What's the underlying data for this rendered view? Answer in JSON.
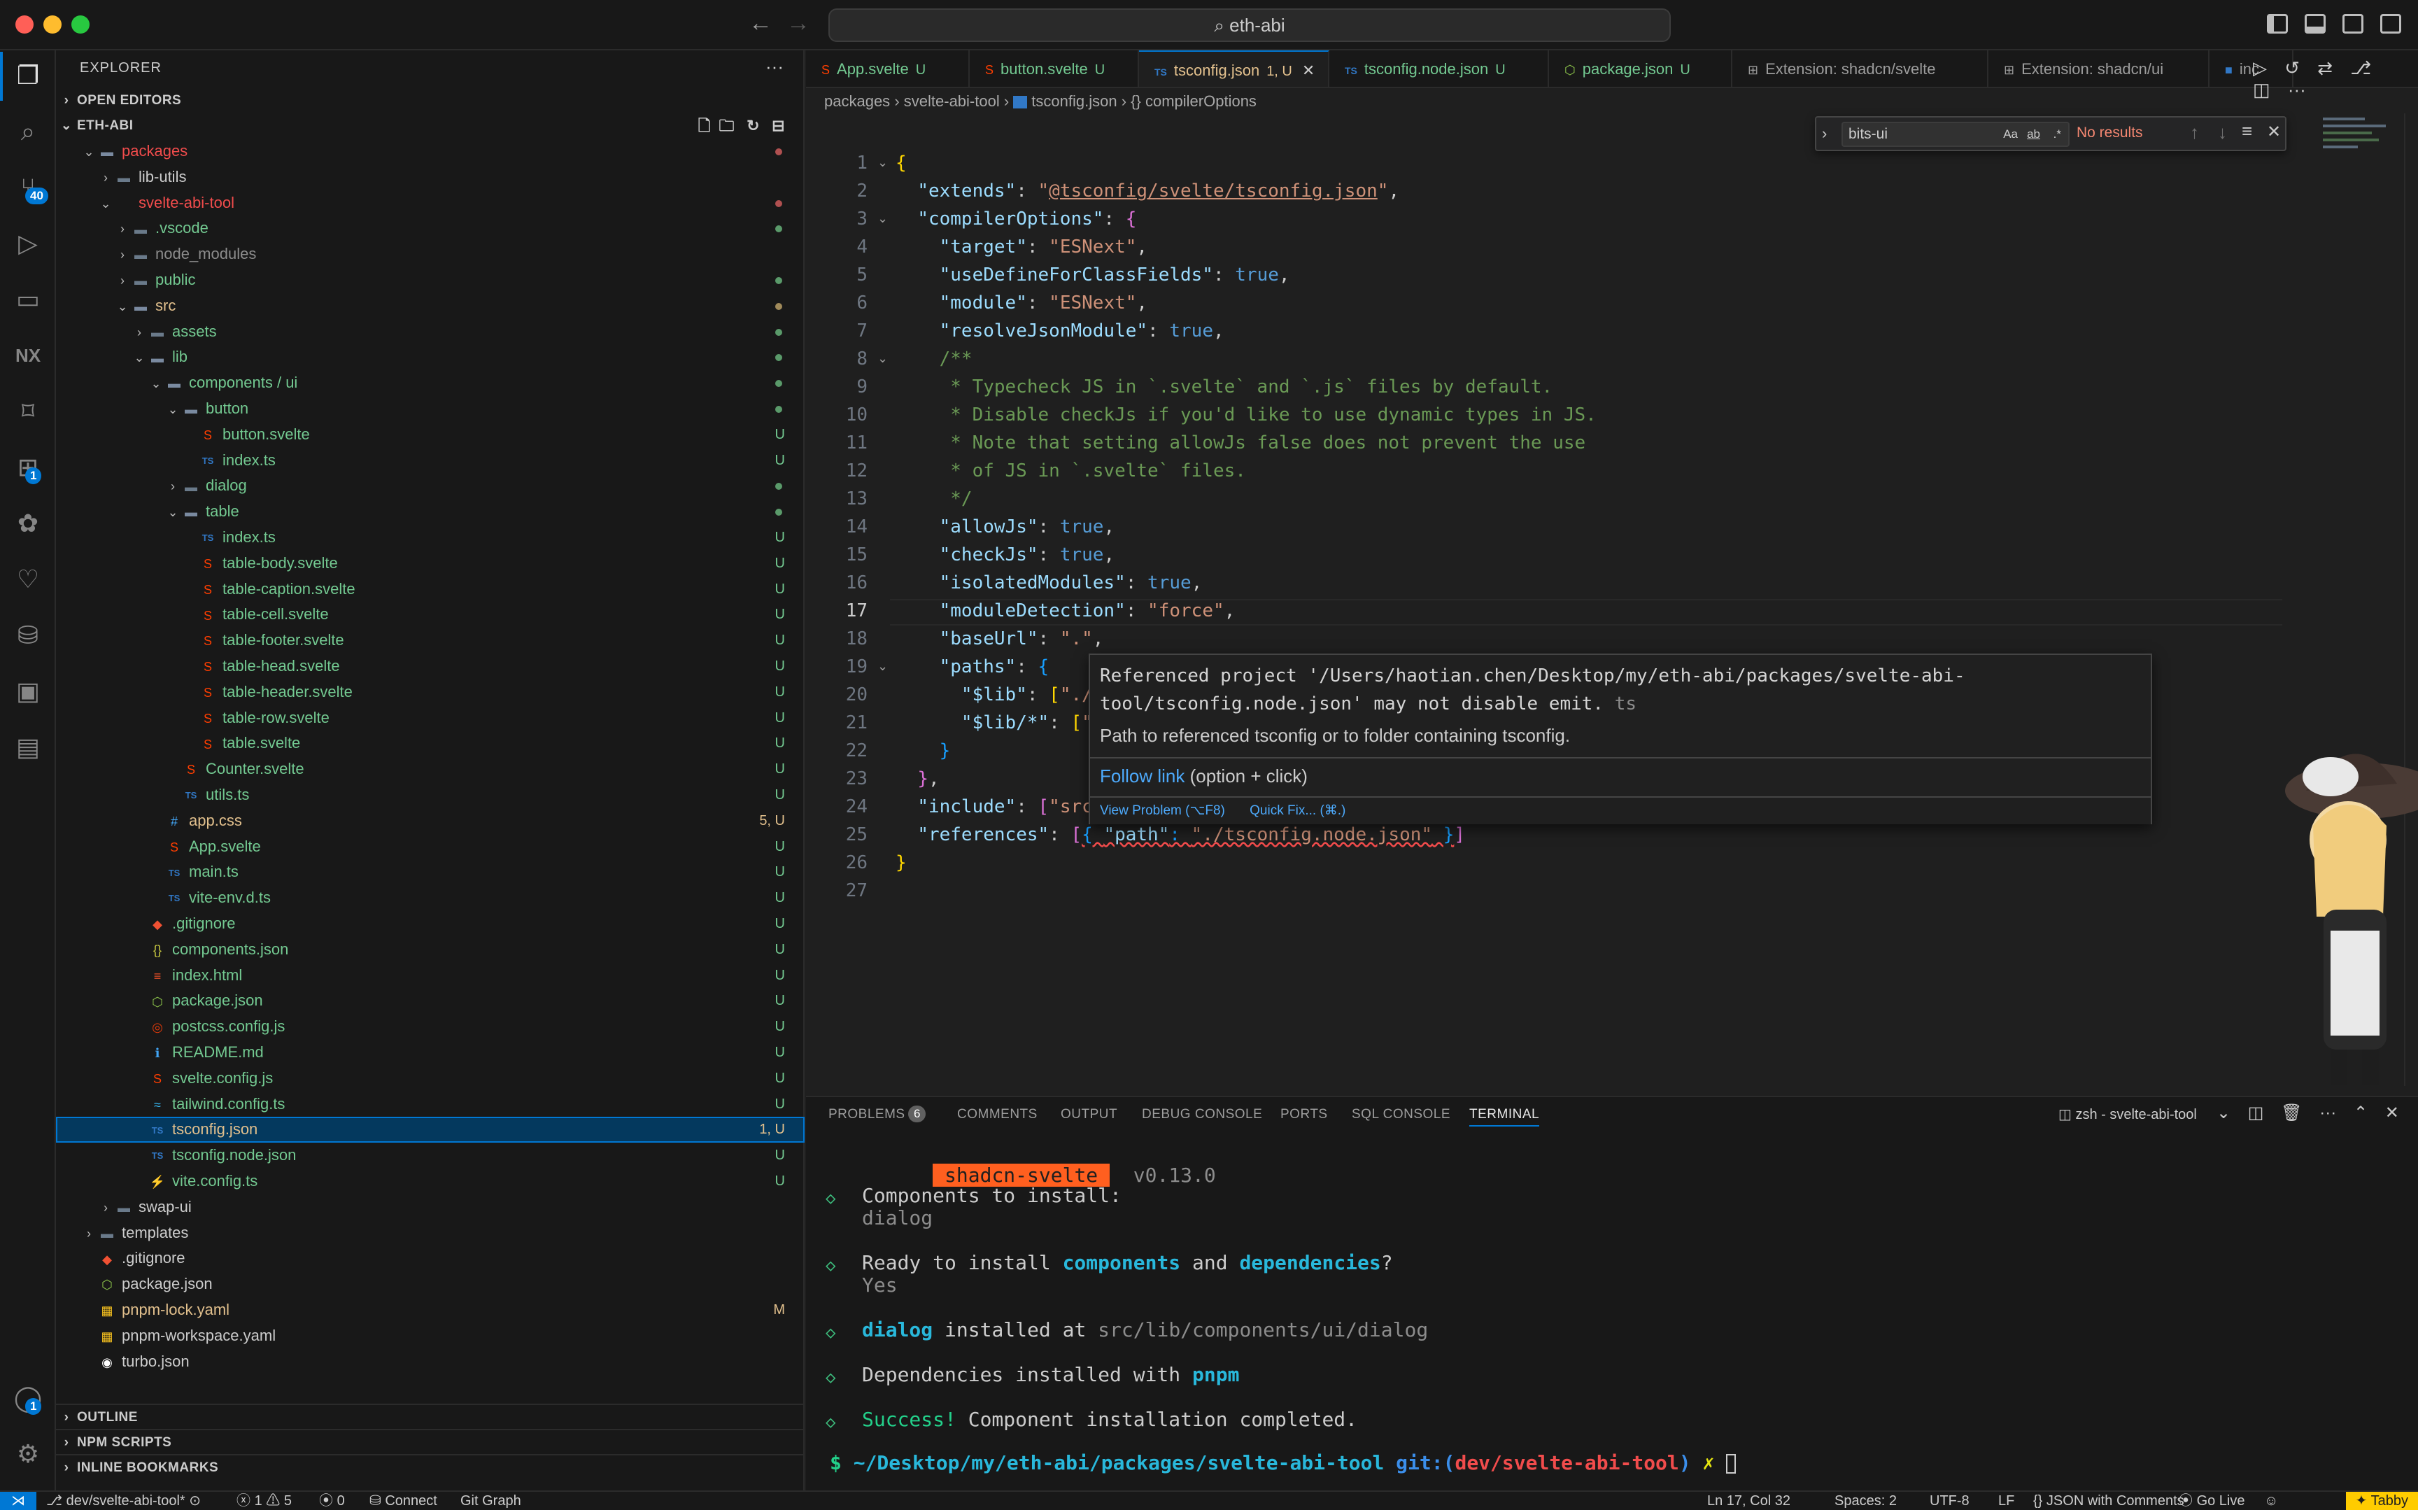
{
  "window": {
    "command_center": "eth-abi"
  },
  "activity": {
    "scm_badge": "40",
    "extensions_badge": "1",
    "accounts_badge": "1"
  },
  "sidebar": {
    "title": "EXPLORER",
    "open_editors": "OPEN EDITORS",
    "root": "ETH-ABI",
    "outline": "OUTLINE",
    "npm_scripts": "NPM SCRIPTS",
    "inline_bookmarks": "INLINE BOOKMARKS",
    "tree": [
      {
        "label": "packages",
        "indent": 1,
        "type": "folder-open",
        "color": "#f14c4c",
        "status": "",
        "dot": "#b05050"
      },
      {
        "label": "lib-utils",
        "indent": 2,
        "type": "folder",
        "color": "#cccccc",
        "status": "",
        "dot": ""
      },
      {
        "label": "svelte-abi-tool",
        "indent": 2,
        "type": "folder-open-plain",
        "color": "#f14c4c",
        "status": "",
        "dot": "#b05050"
      },
      {
        "label": ".vscode",
        "indent": 3,
        "type": "folder",
        "color": "#73c991",
        "status": "",
        "dot": "#5a9a6a"
      },
      {
        "label": "node_modules",
        "indent": 3,
        "type": "folder",
        "color": "#8c8c8c",
        "status": "",
        "dot": ""
      },
      {
        "label": "public",
        "indent": 3,
        "type": "folder",
        "color": "#73c991",
        "status": "",
        "dot": "#5a9a6a"
      },
      {
        "label": "src",
        "indent": 3,
        "type": "folder-open",
        "color": "#e2c08d",
        "status": "",
        "dot": "#a08a5a"
      },
      {
        "label": "assets",
        "indent": 4,
        "type": "folder",
        "color": "#73c991",
        "status": "",
        "dot": "#5a9a6a"
      },
      {
        "label": "lib",
        "indent": 4,
        "type": "folder-open",
        "color": "#73c991",
        "status": "",
        "dot": "#5a9a6a"
      },
      {
        "label": "components / ui",
        "indent": 5,
        "type": "folder-open",
        "color": "#73c991",
        "status": "",
        "dot": "#5a9a6a"
      },
      {
        "label": "button",
        "indent": 6,
        "type": "folder-open",
        "color": "#73c991",
        "status": "",
        "dot": "#5a9a6a"
      },
      {
        "label": "button.svelte",
        "indent": 7,
        "type": "svelte",
        "color": "#73c991",
        "status": "U",
        "dot": ""
      },
      {
        "label": "index.ts",
        "indent": 7,
        "type": "ts",
        "color": "#73c991",
        "status": "U",
        "dot": ""
      },
      {
        "label": "dialog",
        "indent": 6,
        "type": "folder",
        "color": "#73c991",
        "status": "",
        "dot": "#5a9a6a"
      },
      {
        "label": "table",
        "indent": 6,
        "type": "folder-open",
        "color": "#73c991",
        "status": "",
        "dot": "#5a9a6a"
      },
      {
        "label": "index.ts",
        "indent": 7,
        "type": "ts",
        "color": "#73c991",
        "status": "U",
        "dot": ""
      },
      {
        "label": "table-body.svelte",
        "indent": 7,
        "type": "svelte",
        "color": "#73c991",
        "status": "U",
        "dot": ""
      },
      {
        "label": "table-caption.svelte",
        "indent": 7,
        "type": "svelte",
        "color": "#73c991",
        "status": "U",
        "dot": ""
      },
      {
        "label": "table-cell.svelte",
        "indent": 7,
        "type": "svelte",
        "color": "#73c991",
        "status": "U",
        "dot": ""
      },
      {
        "label": "table-footer.svelte",
        "indent": 7,
        "type": "svelte",
        "color": "#73c991",
        "status": "U",
        "dot": ""
      },
      {
        "label": "table-head.svelte",
        "indent": 7,
        "type": "svelte",
        "color": "#73c991",
        "status": "U",
        "dot": ""
      },
      {
        "label": "table-header.svelte",
        "indent": 7,
        "type": "svelte",
        "color": "#73c991",
        "status": "U",
        "dot": ""
      },
      {
        "label": "table-row.svelte",
        "indent": 7,
        "type": "svelte",
        "color": "#73c991",
        "status": "U",
        "dot": ""
      },
      {
        "label": "table.svelte",
        "indent": 7,
        "type": "svelte",
        "color": "#73c991",
        "status": "U",
        "dot": ""
      },
      {
        "label": "Counter.svelte",
        "indent": 6,
        "type": "svelte",
        "color": "#73c991",
        "status": "U",
        "dot": ""
      },
      {
        "label": "utils.ts",
        "indent": 6,
        "type": "ts",
        "color": "#73c991",
        "status": "U",
        "dot": ""
      },
      {
        "label": "app.css",
        "indent": 5,
        "type": "css",
        "color": "#e2c08d",
        "status": "5, U",
        "dot": ""
      },
      {
        "label": "App.svelte",
        "indent": 5,
        "type": "svelte",
        "color": "#73c991",
        "status": "U",
        "dot": ""
      },
      {
        "label": "main.ts",
        "indent": 5,
        "type": "ts",
        "color": "#73c991",
        "status": "U",
        "dot": ""
      },
      {
        "label": "vite-env.d.ts",
        "indent": 5,
        "type": "ts",
        "color": "#73c991",
        "status": "U",
        "dot": ""
      },
      {
        "label": ".gitignore",
        "indent": 4,
        "type": "git",
        "color": "#73c991",
        "status": "U",
        "dot": ""
      },
      {
        "label": "components.json",
        "indent": 4,
        "type": "json",
        "color": "#73c991",
        "status": "U",
        "dot": ""
      },
      {
        "label": "index.html",
        "indent": 4,
        "type": "html",
        "color": "#73c991",
        "status": "U",
        "dot": ""
      },
      {
        "label": "package.json",
        "indent": 4,
        "type": "node",
        "color": "#73c991",
        "status": "U",
        "dot": ""
      },
      {
        "label": "postcss.config.js",
        "indent": 4,
        "type": "postcss",
        "color": "#73c991",
        "status": "U",
        "dot": ""
      },
      {
        "label": "README.md",
        "indent": 4,
        "type": "info",
        "color": "#73c991",
        "status": "U",
        "dot": ""
      },
      {
        "label": "svelte.config.js",
        "indent": 4,
        "type": "svelte",
        "color": "#73c991",
        "status": "U",
        "dot": ""
      },
      {
        "label": "tailwind.config.ts",
        "indent": 4,
        "type": "tailwind",
        "color": "#73c991",
        "status": "U",
        "dot": ""
      },
      {
        "label": "tsconfig.json",
        "indent": 4,
        "type": "ts",
        "color": "#e2c08d",
        "status": "1, U",
        "dot": "",
        "selected": true
      },
      {
        "label": "tsconfig.node.json",
        "indent": 4,
        "type": "ts",
        "color": "#73c991",
        "status": "U",
        "dot": ""
      },
      {
        "label": "vite.config.ts",
        "indent": 4,
        "type": "vite",
        "color": "#73c991",
        "status": "U",
        "dot": ""
      },
      {
        "label": "swap-ui",
        "indent": 2,
        "type": "folder",
        "color": "#cccccc",
        "status": "",
        "dot": ""
      },
      {
        "label": "templates",
        "indent": 1,
        "type": "folder",
        "color": "#cccccc",
        "status": "",
        "dot": ""
      },
      {
        "label": ".gitignore",
        "indent": 1,
        "type": "git",
        "color": "#cccccc",
        "status": "",
        "dot": ""
      },
      {
        "label": "package.json",
        "indent": 1,
        "type": "node",
        "color": "#cccccc",
        "status": "",
        "dot": ""
      },
      {
        "label": "pnpm-lock.yaml",
        "indent": 1,
        "type": "yaml",
        "color": "#e2c08d",
        "status": "M",
        "dot": ""
      },
      {
        "label": "pnpm-workspace.yaml",
        "indent": 1,
        "type": "yaml",
        "color": "#cccccc",
        "status": "",
        "dot": ""
      },
      {
        "label": "turbo.json",
        "indent": 1,
        "type": "turbo",
        "color": "#cccccc",
        "status": "",
        "dot": ""
      }
    ]
  },
  "tabs": [
    {
      "label": "App.svelte",
      "suffix": "U",
      "active": false
    },
    {
      "label": "button.svelte",
      "suffix": "U",
      "active": false
    },
    {
      "label": "tsconfig.json",
      "suffix": "1, U",
      "active": true
    },
    {
      "label": "tsconfig.node.json",
      "suffix": "U",
      "active": false
    },
    {
      "label": "package.json",
      "suffix": "U",
      "active": false
    },
    {
      "label": "Extension: shadcn/svelte",
      "suffix": "",
      "active": false
    },
    {
      "label": "Extension: shadcn/ui",
      "suffix": "",
      "active": false
    },
    {
      "label": "inc",
      "suffix": "",
      "active": false
    }
  ],
  "breadcrumb": {
    "p1": "packages",
    "p2": "svelte-abi-tool",
    "p3": "tsconfig.json",
    "p4": "{} compilerOptions"
  },
  "find": {
    "value": "bits-ui",
    "result": "No results"
  },
  "hover": {
    "message": "Referenced project '/Users/haotian.chen/Desktop/my/eth-abi/packages/svelte-abi-tool/tsconfig.node.json' may not disable emit.",
    "source": "ts",
    "description": "Path to referenced tsconfig or to folder containing tsconfig.",
    "follow_link": "Follow link",
    "follow_hint": "(option + click)",
    "view_problem": "View Problem (⌥F8)",
    "quick_fix": "Quick Fix... (⌘.)"
  },
  "panel": {
    "tabs": [
      "PROBLEMS",
      "COMMENTS",
      "OUTPUT",
      "DEBUG CONSOLE",
      "PORTS",
      "SQL CONSOLE",
      "TERMINAL"
    ],
    "problems_count": "6",
    "terminal_name": "zsh - svelte-abi-tool",
    "terminal": {
      "badge": " shadcn-svelte ",
      "version": "v0.13.0",
      "l1": "Components to install:",
      "l2": "dialog",
      "l3a": "Ready to install ",
      "l3b": "components",
      "l3c": " and ",
      "l3d": "dependencies",
      "l3e": "?",
      "l4": "Yes",
      "l5a": "dialog",
      "l5b": " installed at ",
      "l5c": "src/lib/components/ui/dialog",
      "l6a": "Dependencies installed with ",
      "l6b": "pnpm",
      "l7a": "Success!",
      "l7b": " Component installation completed.",
      "prompt_dollar": "$",
      "prompt_path": "~/Desktop/my/eth-abi/packages/svelte-abi-tool",
      "prompt_git": " git:(",
      "prompt_branch": "dev/svelte-abi-tool",
      "prompt_close": ")",
      "prompt_x": "✗"
    }
  },
  "statusbar": {
    "branch": "dev/svelte-abi-tool*",
    "errors": "1",
    "warnings": "5",
    "ports": "0",
    "connect": "Connect",
    "git_graph": "Git Graph",
    "position": "Ln 17, Col 32",
    "spaces": "Spaces: 2",
    "encoding": "UTF-8",
    "eol": "LF",
    "language": "JSON with Comments",
    "golive": "Go Live",
    "tabby": "Tabby"
  },
  "colors": {
    "accent": "#0078d4",
    "untracked": "#73c991",
    "modified": "#e2c08d",
    "svelte": "#ff3e00"
  }
}
